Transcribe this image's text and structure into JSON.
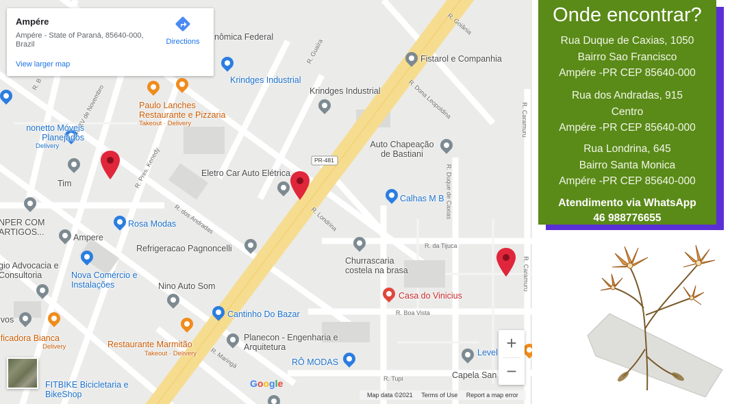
{
  "map": {
    "info_card": {
      "place_name": "Ampére",
      "address": "Ampére - State of Paraná, 85640-000, Brazil",
      "directions_label": "Directions",
      "view_larger_label": "View larger map"
    },
    "pois": {
      "economica": "nômica Federal",
      "krindges_blue": "Krindges Industrial",
      "fistarol": "Fistarol e Companhia",
      "krindges_gray": "Krindges Industrial",
      "paulo_lanches": "Paulo Lanches Restaurante e Pizzaria",
      "paulo_sub": "Takeout · Delivery",
      "menetto": "nonetto Móveis Planejados",
      "menetto_sub": "Delivery",
      "auto_chapeacao": "Auto Chapeação de Bastiani",
      "eletro_car": "Eletro Car Auto Elétrica",
      "tim": "Tim",
      "calhas": "Calhas M B",
      "unper": "NPER COM ARTIGOS...",
      "rosa_modas": "Rosa Modas",
      "ampere": "Ampere",
      "refrigeracao": "Refrigeracao Pagnoncelli",
      "churrascaria": "Churrascaria costela na brasa",
      "advocacia": "gio Advocacia e Consultoria",
      "nova_comercio": "Nova Comércio e Instalações",
      "nino": "Nino Auto Som",
      "casa_vinicius": "Casa do Vinicius",
      "vivos": "ivos",
      "cantinho": "Cantinho Do Bazar",
      "bianca": "ificadora Bianca",
      "bianca_sub": "Delivery",
      "marmitao": "Restaurante Marmitão",
      "marmitao_sub": "Takeout · Delivery",
      "planecon": "Planecon - Engenharia e Arquitetura",
      "ro_modas": "RÔ MODAS",
      "level": "Level",
      "capela": "Capela San",
      "fitbike": "FITBIKE Bicicletaria e BikeShop"
    },
    "streets": {
      "goiania": "R. Goiânia",
      "guaira": "R. Guaíra",
      "dona_leopoldina": "R. Dona Leopoldina",
      "caramuru_top": "R. Caramuru",
      "xv_novembro": "R. XV de Novembro",
      "pres_kenedy": "R. Pres. Kenedy",
      "pr481": "PR-481",
      "duque_caxias": "R. Duque de Caxias",
      "dos_andradas": "R. dos Andradas",
      "londrina": "R. Londrina",
      "da_tijuca": "R. da Tijuca",
      "caramuru_bottom": "R. Caramuru",
      "boa_vista": "R. Boa Vista",
      "maringa": "R. Maringá",
      "tupi": "R. Tupi",
      "r_b": "R. B"
    },
    "zoom_in": "+",
    "zoom_out": "−",
    "google": "Google",
    "attribution": {
      "map_data": "Map data ©2021",
      "terms": "Terms of Use",
      "report": "Report a map error"
    }
  },
  "panel": {
    "title": "Onde encontrar?",
    "addresses": [
      [
        "Rua Duque de Caxias, 1050",
        "Bairro Sao Francisco",
        "Ampére -PR CEP 85640-000"
      ],
      [
        "Rua dos Andradas, 915",
        "Centro",
        "Ampére -PR CEP 85640-000"
      ],
      [
        "Rua Londrina, 645",
        "Bairro Santa Monica",
        "Ampére -PR CEP 85640-000"
      ]
    ],
    "whatsapp": [
      "Atendimento via WhatsApp",
      "46 988776655"
    ]
  },
  "colors": {
    "panel_bg": "#5a8a18",
    "panel_shadow": "#5b2fd6",
    "highway": "#f6dc8e",
    "marker_red": "#e0263b"
  },
  "icons": [
    "directions-icon",
    "map-marker-icon",
    "poi-pin-icon",
    "zoom-in-icon",
    "zoom-out-icon",
    "pressed-flower-illustration"
  ]
}
